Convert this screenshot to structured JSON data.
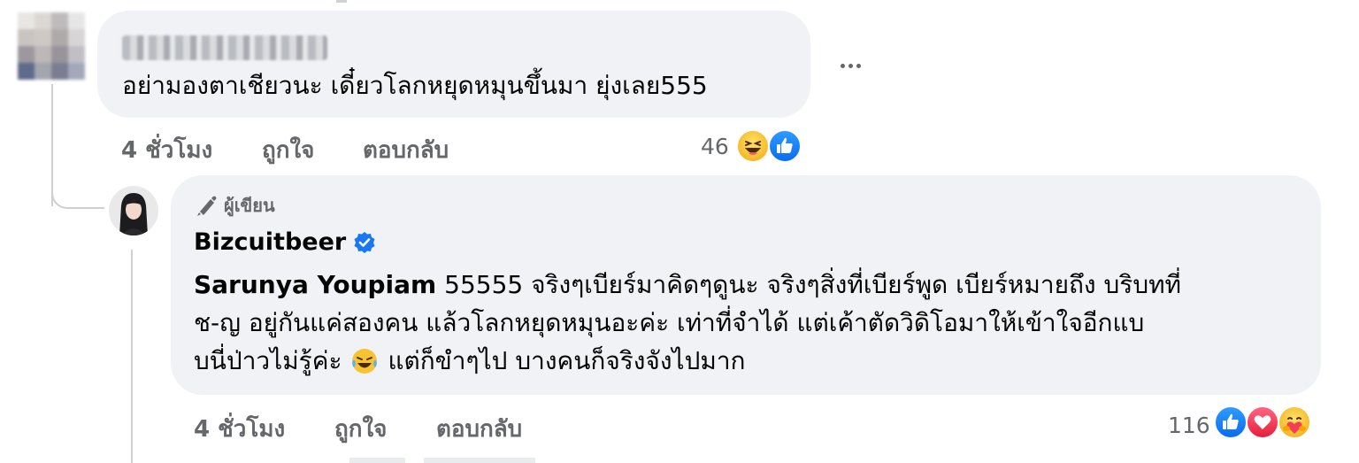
{
  "comment": {
    "text": "อย่ามองตาเชียวนะ เดี๋ยวโลกหยุดหมุนขึ้นมา ยุ่งเลย555",
    "time": "4 ชั่วโมง",
    "like_label": "ถูกใจ",
    "reply_label": "ตอบกลับ",
    "reaction_count": "46",
    "reactions": [
      "haha-icon",
      "like-icon"
    ]
  },
  "reply": {
    "author_badge": "ผู้เขียน",
    "author_name": "Bizcuitbeer",
    "verified_icon": "verified-check-icon",
    "mention": "Sarunya Youpiam",
    "line1_text": "55555 จริงๆเบียร์มาคิดๆดูนะ จริงๆสิ่งที่เบียร์พูด เบียร์หมายถึง บริบทที่",
    "line2_text": "ช-ญ อยู่กันแค่สองคน แล้วโลกหยุดหมุนอะค่ะ เท่าที่จำได้ แต่เค้าตัดวิดิโอมาให้เข้าใจอีกแบ",
    "line3_before_emoji": "บนี่ป่าวไม่รู้ค่ะ",
    "line3_after_emoji": "แต่ก็ขำๆไป บางคนก็จริงจังไปมาก",
    "inline_emoji": "laughing-tears-emoji",
    "time": "4 ชั่วโมง",
    "like_label": "ถูกใจ",
    "reply_label": "ตอบกลับ",
    "reaction_count": "116",
    "reactions": [
      "like-icon",
      "love-icon",
      "care-icon"
    ]
  },
  "colors": {
    "bubble": "#f0f2f5",
    "secondary_text": "#65676b",
    "like_blue": "#1877f2",
    "love_red": "#f33e58",
    "haha_yellow": "#f7b928"
  }
}
